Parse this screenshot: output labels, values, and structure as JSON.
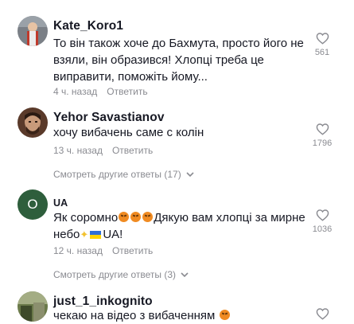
{
  "comments": [
    {
      "username": "Kate_Koro1",
      "text": "То він також хоче до Бахмута, просто його не взяли, він образився! Хлопці треба це виправити, поможіть йому...",
      "time": "4 ч. назад",
      "reply": "Ответить",
      "likes": "561"
    },
    {
      "username": "Yehor Savastianov",
      "text": "хочу вибачень саме с колін",
      "time": "13 ч. назад",
      "reply": "Ответить",
      "likes": "1796",
      "more_replies": "Смотреть другие ответы (17)"
    },
    {
      "username": "UA",
      "avatar_letter": "O",
      "text_part1": "Як соромно",
      "text_part2": "Дякую вам хлопці за мирне небо",
      "text_part3": "UA!",
      "time": "12 ч. назад",
      "reply": "Ответить",
      "likes": "1036",
      "more_replies": "Смотреть другие ответы (3)"
    },
    {
      "username": "just_1_inkognito",
      "text": "чекаю на відео з вибаченням"
    }
  ],
  "colors": {
    "text": "#161823",
    "muted": "#8a8b91",
    "avatar_green": "#2e5e3c"
  },
  "icons": [
    "heart-outline-icon",
    "chevron-down-icon",
    "angry-face-emoji",
    "pray-emoji",
    "ukraine-flag"
  ]
}
